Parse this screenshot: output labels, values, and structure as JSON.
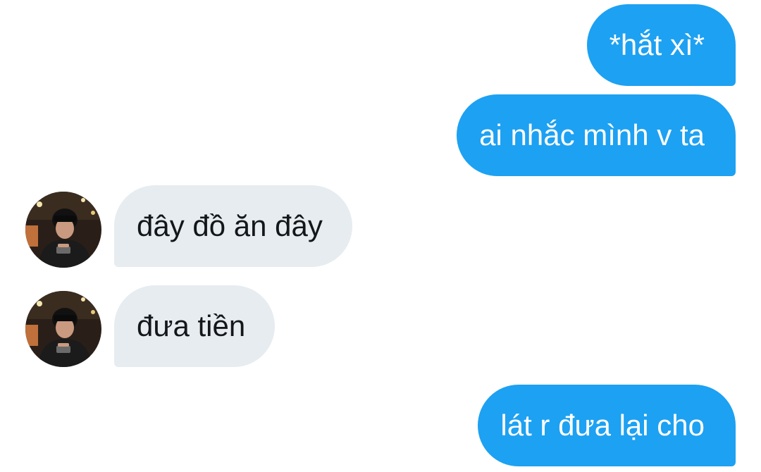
{
  "conversation": {
    "messages": [
      {
        "direction": "outgoing",
        "text": "*hắt xì*"
      },
      {
        "direction": "outgoing",
        "text": "ai nhắc mình v ta"
      },
      {
        "direction": "incoming",
        "text": "đây đồ ăn đây",
        "avatar_icon": "user-avatar-icon"
      },
      {
        "direction": "incoming",
        "text": "đưa tiền",
        "avatar_icon": "user-avatar-icon"
      },
      {
        "direction": "outgoing",
        "text": "lát r đưa lại cho"
      }
    ]
  },
  "colors": {
    "outgoing_bubble": "#1da1f2",
    "outgoing_text": "#ffffff",
    "incoming_bubble": "#e6ecf0",
    "incoming_text": "#14171a",
    "background": "#ffffff"
  }
}
